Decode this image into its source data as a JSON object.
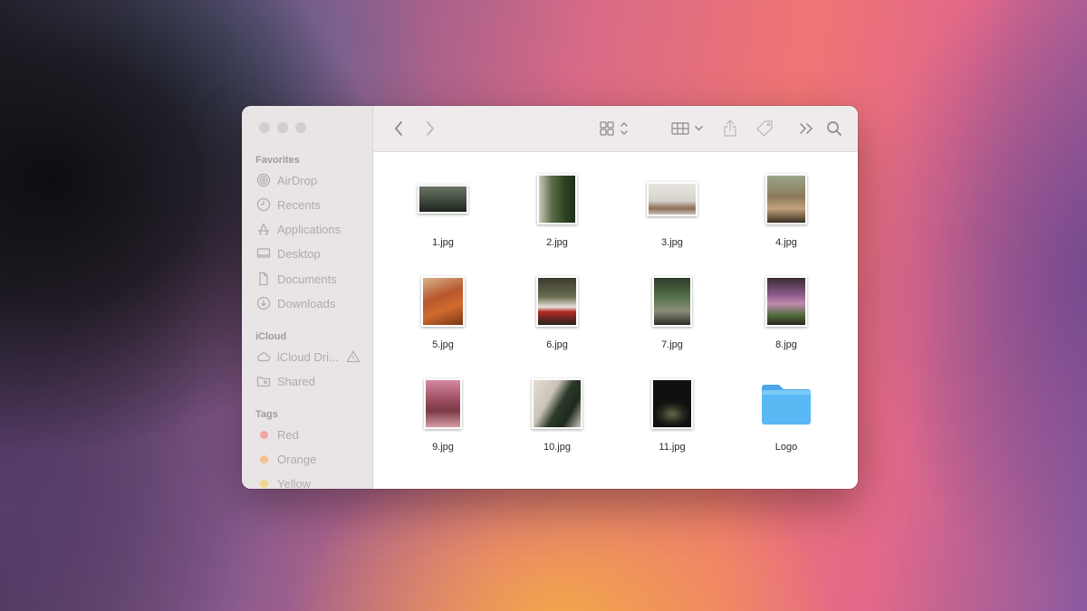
{
  "sidebar": {
    "favorites_label": "Favorites",
    "favorites": [
      {
        "label": "AirDrop",
        "icon": "airdrop-icon"
      },
      {
        "label": "Recents",
        "icon": "clock-icon"
      },
      {
        "label": "Applications",
        "icon": "applications-icon"
      },
      {
        "label": "Desktop",
        "icon": "desktop-icon"
      },
      {
        "label": "Documents",
        "icon": "document-icon"
      },
      {
        "label": "Downloads",
        "icon": "download-icon"
      }
    ],
    "icloud_label": "iCloud",
    "icloud": [
      {
        "label": "iCloud Dri...",
        "icon": "cloud-icon"
      },
      {
        "label": "Shared",
        "icon": "shared-folder-icon"
      }
    ],
    "tags_label": "Tags",
    "tags": [
      {
        "label": "Red",
        "color": "#f3a3a3"
      },
      {
        "label": "Orange",
        "color": "#f5c08f"
      },
      {
        "label": "Yellow",
        "color": "#f3d58a"
      }
    ]
  },
  "toolbar": {
    "icons": [
      "back-icon",
      "forward-icon",
      "icon-view-icon",
      "group-icon",
      "share-icon",
      "tag-icon",
      "more-icon",
      "search-icon"
    ]
  },
  "files": [
    {
      "name": "1.jpg"
    },
    {
      "name": "2.jpg"
    },
    {
      "name": "3.jpg"
    },
    {
      "name": "4.jpg"
    },
    {
      "name": "5.jpg"
    },
    {
      "name": "6.jpg"
    },
    {
      "name": "7.jpg"
    },
    {
      "name": "8.jpg"
    },
    {
      "name": "9.jpg"
    },
    {
      "name": "10.jpg"
    },
    {
      "name": "11.jpg"
    },
    {
      "name": "Logo"
    }
  ],
  "colors": {
    "folder_blue": "#5ab8f5",
    "sidebar_bg": "#e9e4e5",
    "toolbar_bg": "#efebec"
  }
}
